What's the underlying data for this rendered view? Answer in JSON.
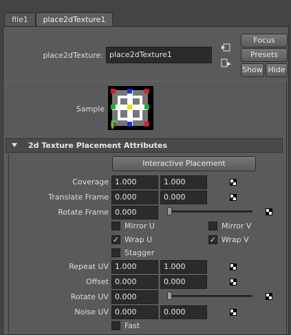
{
  "tabs": [
    {
      "label": "file1",
      "active": false
    },
    {
      "label": "place2dTexture1",
      "active": true
    }
  ],
  "header": {
    "node_label": "place2dTexture:",
    "node_value": "place2dTexture1",
    "focus_label": "Focus",
    "presets_label": "Presets",
    "show_label": "Show",
    "hide_label": "Hide"
  },
  "sample_label": "Sample",
  "section": {
    "title": "2d Texture Placement Attributes",
    "interactive_label": "Interactive Placement"
  },
  "attributes": {
    "coverage": {
      "label": "Coverage",
      "v1": "1.000",
      "v2": "1.000"
    },
    "translate_frame": {
      "label": "Translate Frame",
      "v1": "0.000",
      "v2": "0.000"
    },
    "rotate_frame": {
      "label": "Rotate Frame",
      "v1": "0.000",
      "slider": 0.0
    },
    "repeat_uv": {
      "label": "Repeat UV",
      "v1": "1.000",
      "v2": "1.000"
    },
    "offset": {
      "label": "Offset",
      "v1": "0.000",
      "v2": "0.000"
    },
    "rotate_uv": {
      "label": "Rotate UV",
      "v1": "0.000",
      "slider": 0.0
    },
    "noise_uv": {
      "label": "Noise UV",
      "v1": "0.000",
      "v2": "0.000"
    }
  },
  "checkboxes": {
    "mirror_u": {
      "label": "Mirror U",
      "checked": false
    },
    "mirror_v": {
      "label": "Mirror V",
      "checked": false
    },
    "wrap_u": {
      "label": "Wrap U",
      "checked": true
    },
    "wrap_v": {
      "label": "Wrap V",
      "checked": true
    },
    "stagger": {
      "label": "Stagger",
      "checked": false
    },
    "fast": {
      "label": "Fast",
      "checked": false
    }
  },
  "colors": {
    "background": "#444444",
    "panel": "#5a5a5a",
    "field": "#2b2b2b"
  }
}
